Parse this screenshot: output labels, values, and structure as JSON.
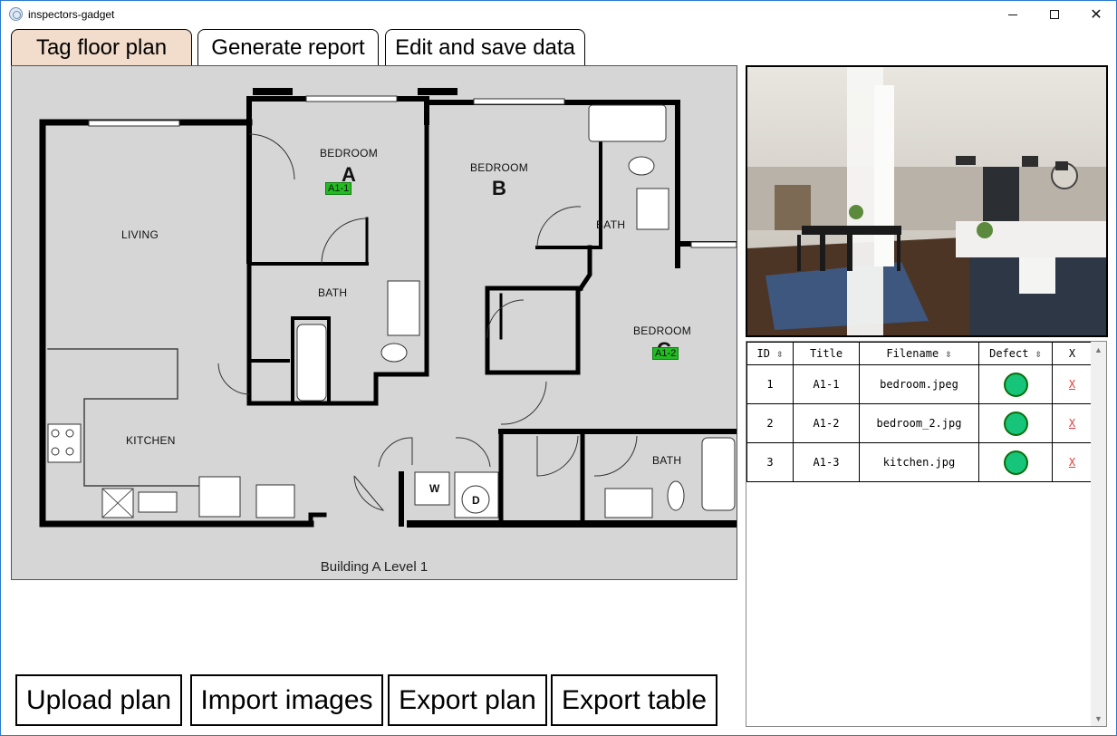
{
  "window": {
    "title": "inspectors-gadget"
  },
  "tabs": [
    {
      "label": "Tag floor plan",
      "active": true
    },
    {
      "label": "Generate report",
      "active": false
    },
    {
      "label": "Edit and save data",
      "active": false
    }
  ],
  "plan": {
    "caption": "Building A Level 1",
    "rooms": {
      "bedroom_a": "BEDROOM",
      "bedroom_a_letter": "A",
      "bedroom_b": "BEDROOM",
      "bedroom_b_letter": "B",
      "bedroom_c": "BEDROOM",
      "bedroom_c_letter": "C",
      "living": "LIVING",
      "kitchen": "KITCHEN",
      "bath_1": "BATH",
      "bath_2": "BATH",
      "bath_3": "BATH",
      "washer": "W",
      "dryer": "D"
    },
    "markers": [
      {
        "label": "A1-1"
      },
      {
        "label": "A1-2"
      }
    ]
  },
  "table": {
    "headers": {
      "id": "ID ⇳",
      "title": "Title",
      "filename": "Filename ⇳",
      "defect": "Defect ⇳",
      "x": "X"
    },
    "rows": [
      {
        "id": "1",
        "title": "A1-1",
        "filename": "bedroom.jpeg",
        "defect_color": "#16c47a",
        "x": "X"
      },
      {
        "id": "2",
        "title": "A1-2",
        "filename": "bedroom_2.jpg",
        "defect_color": "#16c47a",
        "x": "X"
      },
      {
        "id": "3",
        "title": "A1-3",
        "filename": "kitchen.jpg",
        "defect_color": "#16c47a",
        "x": "X"
      }
    ]
  },
  "buttons": {
    "upload_plan": "Upload plan",
    "import_images": "Import images",
    "export_plan": "Export plan",
    "export_table": "Export table"
  },
  "colors": {
    "active_tab": "#f2dccb",
    "marker": "#22bb22",
    "defect_ok": "#16c47a",
    "delete_link": "#e23b3b"
  }
}
